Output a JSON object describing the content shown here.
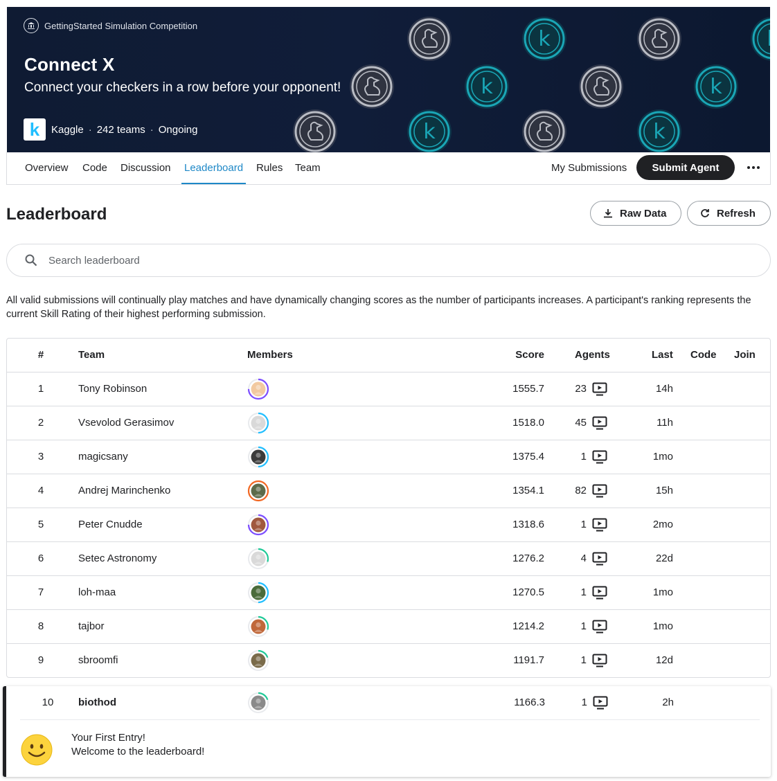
{
  "hero": {
    "competition_type": "GettingStarted Simulation Competition",
    "title": "Connect X",
    "subtitle": "Connect your checkers in a row before your opponent!",
    "host": "Kaggle",
    "host_logo_letter": "k",
    "teams": "242 teams",
    "status": "Ongoing",
    "dot": "·",
    "deco_icons": [
      "goose-coin-icon",
      "kaggle-coin-icon"
    ]
  },
  "tabs": [
    "Overview",
    "Code",
    "Discussion",
    "Leaderboard",
    "Rules",
    "Team"
  ],
  "active_tab": "Leaderboard",
  "actions": {
    "my_submissions": "My Submissions",
    "submit_agent": "Submit Agent"
  },
  "leaderboard": {
    "title": "Leaderboard",
    "raw_data": "Raw Data",
    "refresh": "Refresh",
    "search_placeholder": "Search leaderboard",
    "description": "All valid submissions will continually play matches and have dynamically changing scores as the number of participants increases. A participant's ranking represents the current Skill Rating of their highest performing submission."
  },
  "columns": {
    "rank": "#",
    "team": "Team",
    "members": "Members",
    "score": "Score",
    "agents": "Agents",
    "last": "Last",
    "code": "Code",
    "join": "Join"
  },
  "rows": [
    {
      "rank": "1",
      "team": "Tony Robinson",
      "score": "1555.7",
      "agents": "23",
      "last": "14h",
      "ring": "#7c4dff",
      "ring_fraction": 0.75,
      "avatar": "#f2c9a0"
    },
    {
      "rank": "2",
      "team": "Vsevolod Gerasimov",
      "score": "1518.0",
      "agents": "45",
      "last": "11h",
      "ring": "#20beff",
      "ring_fraction": 0.5,
      "avatar": "#d9d9d9"
    },
    {
      "rank": "3",
      "team": "magicsany",
      "score": "1375.4",
      "agents": "1",
      "last": "1mo",
      "ring": "#20beff",
      "ring_fraction": 0.5,
      "avatar": "#3b3b3b"
    },
    {
      "rank": "4",
      "team": "Andrej Marinchenko",
      "score": "1354.1",
      "agents": "82",
      "last": "15h",
      "ring": "#f26722",
      "ring_fraction": 1.0,
      "avatar": "#5d6b4a"
    },
    {
      "rank": "5",
      "team": "Peter Cnudde",
      "score": "1318.6",
      "agents": "1",
      "last": "2mo",
      "ring": "#7c4dff",
      "ring_fraction": 0.75,
      "avatar": "#a0583e"
    },
    {
      "rank": "6",
      "team": "Setec Astronomy",
      "score": "1276.2",
      "agents": "4",
      "last": "22d",
      "ring": "#20c997",
      "ring_fraction": 0.3,
      "avatar": "#d9d9d9"
    },
    {
      "rank": "7",
      "team": "loh-maa",
      "score": "1270.5",
      "agents": "1",
      "last": "1mo",
      "ring": "#20beff",
      "ring_fraction": 0.5,
      "avatar": "#4a6b3a"
    },
    {
      "rank": "8",
      "team": "tajbor",
      "score": "1214.2",
      "agents": "1",
      "last": "1mo",
      "ring": "#20c997",
      "ring_fraction": 0.3,
      "avatar": "#c0683a"
    },
    {
      "rank": "9",
      "team": "sbroomfi",
      "score": "1191.7",
      "agents": "1",
      "last": "12d",
      "ring": "#20c997",
      "ring_fraction": 0.2,
      "avatar": "#7a6b4a"
    }
  ],
  "my_row": {
    "rank": "10",
    "team": "biothod",
    "score": "1166.3",
    "agents": "1",
    "last": "2h",
    "ring": "#20c997",
    "ring_fraction": 0.2,
    "avatar": "#8a8a8a"
  },
  "toast": {
    "title": "Your First Entry!",
    "message": "Welcome to the leaderboard!",
    "icon": "smiley-icon"
  }
}
